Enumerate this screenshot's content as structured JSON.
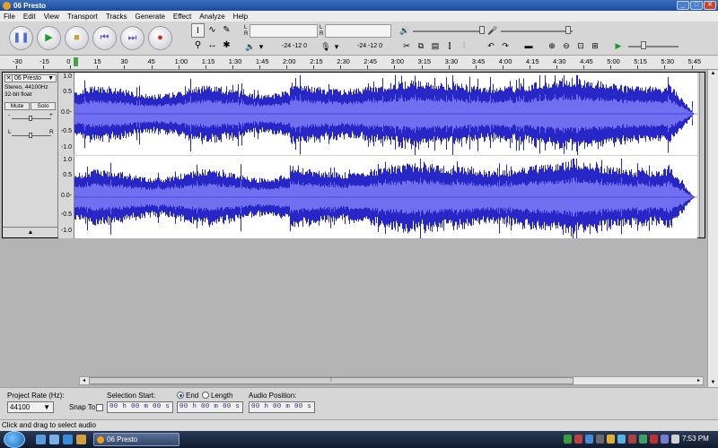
{
  "window": {
    "title": "06 Presto",
    "controls": [
      "_",
      "□",
      "✕"
    ]
  },
  "menu": [
    "File",
    "Edit",
    "View",
    "Transport",
    "Tracks",
    "Generate",
    "Effect",
    "Analyze",
    "Help"
  ],
  "transport": [
    {
      "name": "pause-button",
      "glyph": "❚❚",
      "cls": "g-pause"
    },
    {
      "name": "play-button",
      "glyph": "▶",
      "cls": "g-play"
    },
    {
      "name": "stop-button",
      "glyph": "■",
      "cls": "g-stop"
    },
    {
      "name": "skip-start-button",
      "glyph": "⏮",
      "cls": "g-skip"
    },
    {
      "name": "skip-end-button",
      "glyph": "⏭",
      "cls": "g-skip"
    },
    {
      "name": "record-button",
      "glyph": "●",
      "cls": "g-rec"
    }
  ],
  "tools": [
    "I",
    "∿",
    "✎",
    "⚲",
    "↔",
    "✱"
  ],
  "meters": {
    "playback_l": "L",
    "playback_r": "R",
    "rec_l": "L",
    "rec_r": "R",
    "scale_play": "-24 -12  0",
    "scale_rec": "-24 -12  0"
  },
  "ruler": {
    "labels": [
      "-30",
      "-15",
      "0",
      "15",
      "30",
      "45",
      "1:00",
      "1:15",
      "1:30",
      "1:45",
      "2:00",
      "2:15",
      "2:30",
      "2:45",
      "3:00",
      "3:15",
      "3:30",
      "3:45",
      "4:00",
      "4:15",
      "4:30",
      "4:45",
      "5:00",
      "5:15",
      "5:30",
      "5:45"
    ]
  },
  "track": {
    "name": "06 Presto",
    "close": "✕",
    "menu_arrow": "▼",
    "format": "Stereo, 44100Hz",
    "bits": "32-bit float",
    "mute": "Mute",
    "solo": "Solo",
    "gain_minus": "-",
    "gain_plus": "+",
    "pan_left": "L",
    "pan_right": "R",
    "collapse": "▲",
    "scale": [
      "1.0",
      "0.5",
      "0.0-",
      "-0.5",
      "-1.0"
    ]
  },
  "colors": {
    "wave_dark": "#2727c8",
    "wave_light": "#6f6ff0",
    "wave_bg": "#ffffff"
  },
  "selection": {
    "project_rate_label": "Project Rate (Hz):",
    "project_rate": "44100",
    "snap_to": "Snap To",
    "selection_start_label": "Selection Start:",
    "end_label": "End",
    "length_label": "Length",
    "audio_position_label": "Audio Position:",
    "start_time": "00 h 00 m 00 s",
    "end_time": "00 h 00 m 00 s",
    "audio_position": "00 h 00 m 00 s"
  },
  "status": "Click and drag to select audio",
  "taskbar": {
    "task_label": "06 Presto",
    "clock": "7:53 PM"
  }
}
